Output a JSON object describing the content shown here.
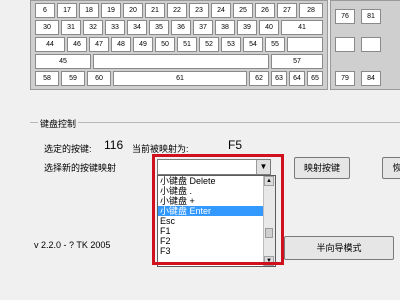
{
  "keyboard": {
    "row1": [
      "6",
      "17",
      "18",
      "19",
      "20",
      "21",
      "22",
      "23",
      "24",
      "25",
      "26",
      "27",
      "28"
    ],
    "row2": [
      "30",
      "31",
      "32",
      "33",
      "34",
      "35",
      "36",
      "37",
      "38",
      "39",
      "40",
      "41"
    ],
    "row3": [
      "44",
      "46",
      "47",
      "48",
      "49",
      "50",
      "51",
      "52",
      "53",
      "54",
      "55"
    ],
    "row4": [
      "45",
      "57"
    ],
    "row5": [
      "58",
      "59",
      "60",
      "61",
      "62",
      "63",
      "64",
      "65"
    ],
    "right_row1": [
      "76",
      "81"
    ],
    "right_row5": [
      "79",
      "84"
    ]
  },
  "panel": {
    "title": "键盘控制",
    "selected_key_label": "选定的按键:",
    "selected_key_value": "116",
    "current_mapping_label": "当前被映射为:",
    "current_mapping_value": "F5",
    "choose_mapping_label": "选择新的按键映射",
    "map_button": "映射按键",
    "restore_button_partial": "恢",
    "version": "v 2.2.0 - ? TK 2005",
    "half_mode_button": "半向导模式"
  },
  "combo": {
    "value": ""
  },
  "dropdown": {
    "items": [
      "小键盘 Delete",
      "小键盘 .",
      "小键盘 +",
      "小键盘 Enter",
      "Esc",
      "F1",
      "F2",
      "F3"
    ],
    "selected_index": 3
  },
  "colors": {
    "highlight": "#d0101c",
    "selection": "#3399ff"
  }
}
